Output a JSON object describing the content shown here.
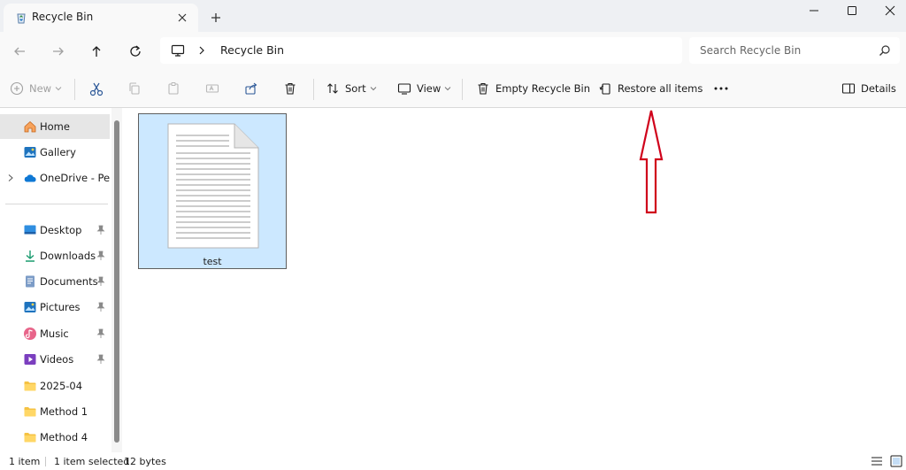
{
  "window": {
    "tab_title": "Recycle Bin",
    "icons": [
      "recycle-bin-icon",
      "close-icon",
      "plus-icon",
      "minimize-icon",
      "maximize-icon",
      "close-window-icon"
    ]
  },
  "address_bar": {
    "breadcrumb": "Recycle Bin",
    "search_placeholder": "Search Recycle Bin"
  },
  "toolbar": {
    "new_label": "New",
    "sort_label": "Sort",
    "view_label": "View",
    "empty_label": "Empty Recycle Bin",
    "restore_label": "Restore all items",
    "details_label": "Details"
  },
  "sidebar": {
    "items": [
      {
        "label": "Home",
        "icon": "home-icon"
      },
      {
        "label": "Gallery",
        "icon": "gallery-icon"
      },
      {
        "label": "OneDrive - Personal",
        "icon": "onedrive-icon"
      },
      {
        "label": "Desktop",
        "icon": "desktop-icon"
      },
      {
        "label": "Downloads",
        "icon": "downloads-icon"
      },
      {
        "label": "Documents",
        "icon": "documents-icon"
      },
      {
        "label": "Pictures",
        "icon": "pictures-icon"
      },
      {
        "label": "Music",
        "icon": "music-icon"
      },
      {
        "label": "Videos",
        "icon": "videos-icon"
      },
      {
        "label": "2025-04",
        "icon": "folder-icon"
      },
      {
        "label": "Method 1",
        "icon": "folder-icon"
      },
      {
        "label": "Method 4",
        "icon": "folder-icon"
      }
    ]
  },
  "content": {
    "files": [
      {
        "name": "test",
        "selected": true
      }
    ]
  },
  "status_bar": {
    "item_count": "1 item",
    "selection": "1 item selected",
    "size": "12 bytes"
  },
  "colors": {
    "selection_fill": "#cce8ff",
    "accent": "#0067c0",
    "annotation_arrow": "#d0021b"
  }
}
